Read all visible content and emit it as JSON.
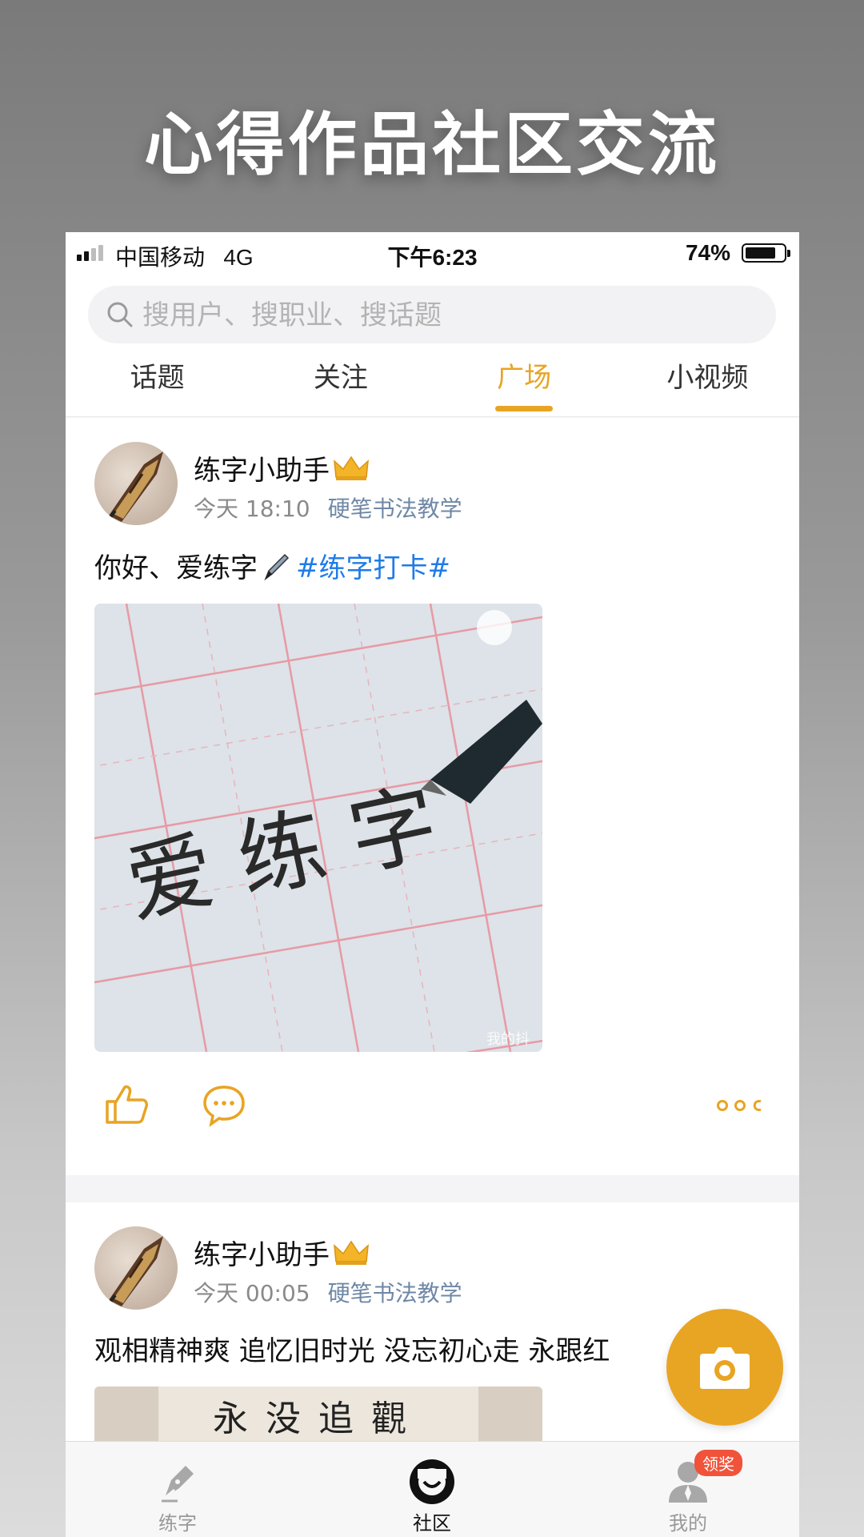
{
  "headline": "心得作品社区交流",
  "status_bar": {
    "carrier": "中国移动",
    "network": "4G",
    "time": "下午6:23",
    "battery": "74%"
  },
  "search": {
    "placeholder": "搜用户、搜职业、搜话题"
  },
  "tabs": [
    {
      "label": "话题",
      "active": false
    },
    {
      "label": "关注",
      "active": false
    },
    {
      "label": "广场",
      "active": true
    },
    {
      "label": "小视频",
      "active": false
    }
  ],
  "posts": [
    {
      "username": "练字小助手",
      "time": "今天 18:10",
      "category": "硬笔书法教学",
      "text": "你好、爱练字",
      "hashtag": "#练字打卡#",
      "image_text": "爱 练 字",
      "watermark": "我的抖"
    },
    {
      "username": "练字小助手",
      "time": "今天 00:05",
      "category": "硬笔书法教学",
      "text": "观相精神爽  追忆旧时光  没忘初心走  永跟红",
      "image_text": "永没追觀"
    }
  ],
  "tabbar": [
    {
      "label": "练字",
      "icon": "pen-nib-icon"
    },
    {
      "label": "社区",
      "icon": "community-icon"
    },
    {
      "label": "我的",
      "icon": "user-icon",
      "badge": "领奖"
    }
  ],
  "colors": {
    "accent": "#e8a423",
    "hashtag": "#1f7be8",
    "category": "#6f88a6",
    "badge": "#f0533a"
  }
}
